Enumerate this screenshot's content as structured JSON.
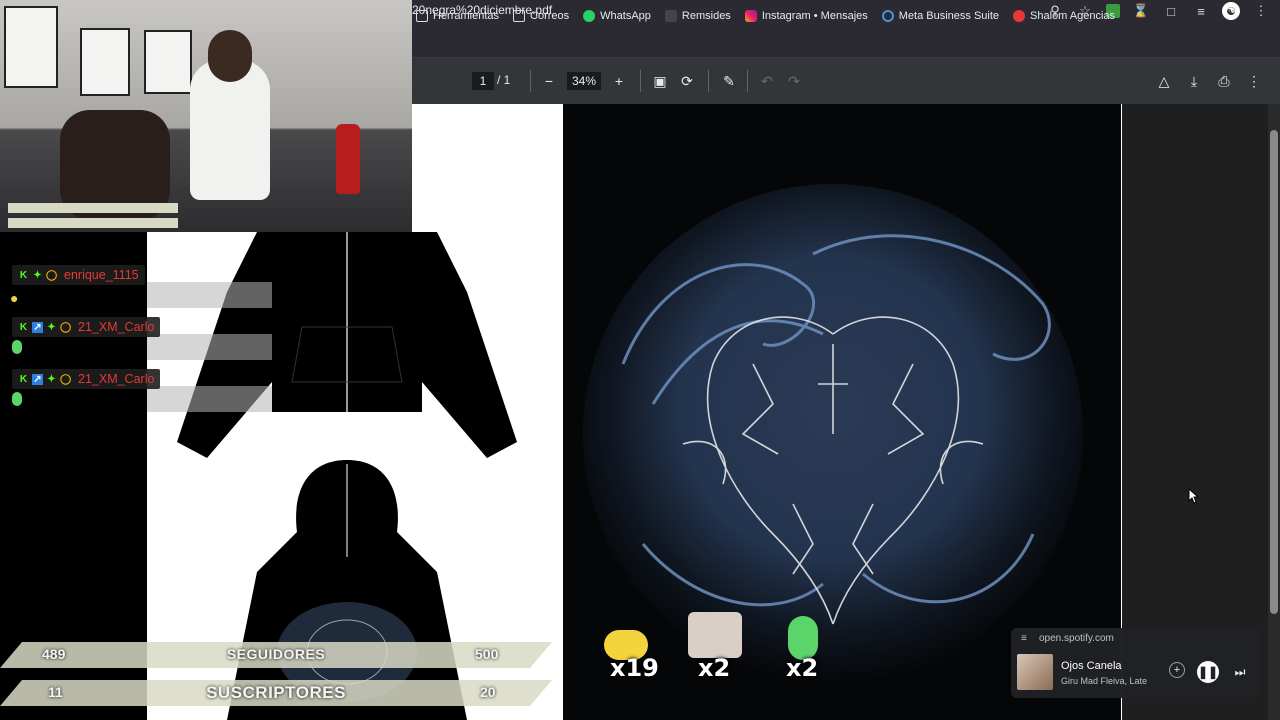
{
  "browser": {
    "tab_title": "20negra%20diciembre.pdf",
    "bookmarks": [
      {
        "label": "Herramientas",
        "icon": "folder-icon"
      },
      {
        "label": "Correos",
        "icon": "folder-icon"
      },
      {
        "label": "WhatsApp",
        "icon": "whatsapp-icon"
      },
      {
        "label": "Remsides",
        "icon": "remsides-icon"
      },
      {
        "label": "Instagram • Mensajes",
        "icon": "instagram-icon"
      },
      {
        "label": "Meta Business Suite",
        "icon": "meta-icon"
      },
      {
        "label": "Shalom Agencias",
        "icon": "shalom-icon"
      }
    ]
  },
  "pdf_toolbar": {
    "current_page": "1",
    "total_pages": "/  1",
    "zoom": "34%"
  },
  "chat": [
    {
      "user": "enrique_1115"
    },
    {
      "user": "21_XM_Carlo"
    },
    {
      "user": "21_XM_Carlo"
    }
  ],
  "stats": {
    "followers": {
      "current": "489",
      "label": "SEGUIDORES",
      "goal": "500"
    },
    "subscribers": {
      "current": "11",
      "label": "SUSCRIPTORES",
      "goal": "20"
    }
  },
  "emotes": [
    {
      "name": "bee-emote",
      "count": "x19"
    },
    {
      "name": "hamster-emote",
      "count": "x2"
    },
    {
      "name": "green-drop-emote",
      "count": "x2"
    }
  ],
  "media_toast": {
    "origin": "open.spotify.com",
    "track": "Ojos Canela",
    "artists": "Giru Mad Fleiva, Late"
  },
  "colors": {
    "chrome_bg": "#2b2a33",
    "pdf_toolbar": "#323639",
    "chat_name": "#e53935",
    "stat_bar": "#d8d9c4"
  }
}
